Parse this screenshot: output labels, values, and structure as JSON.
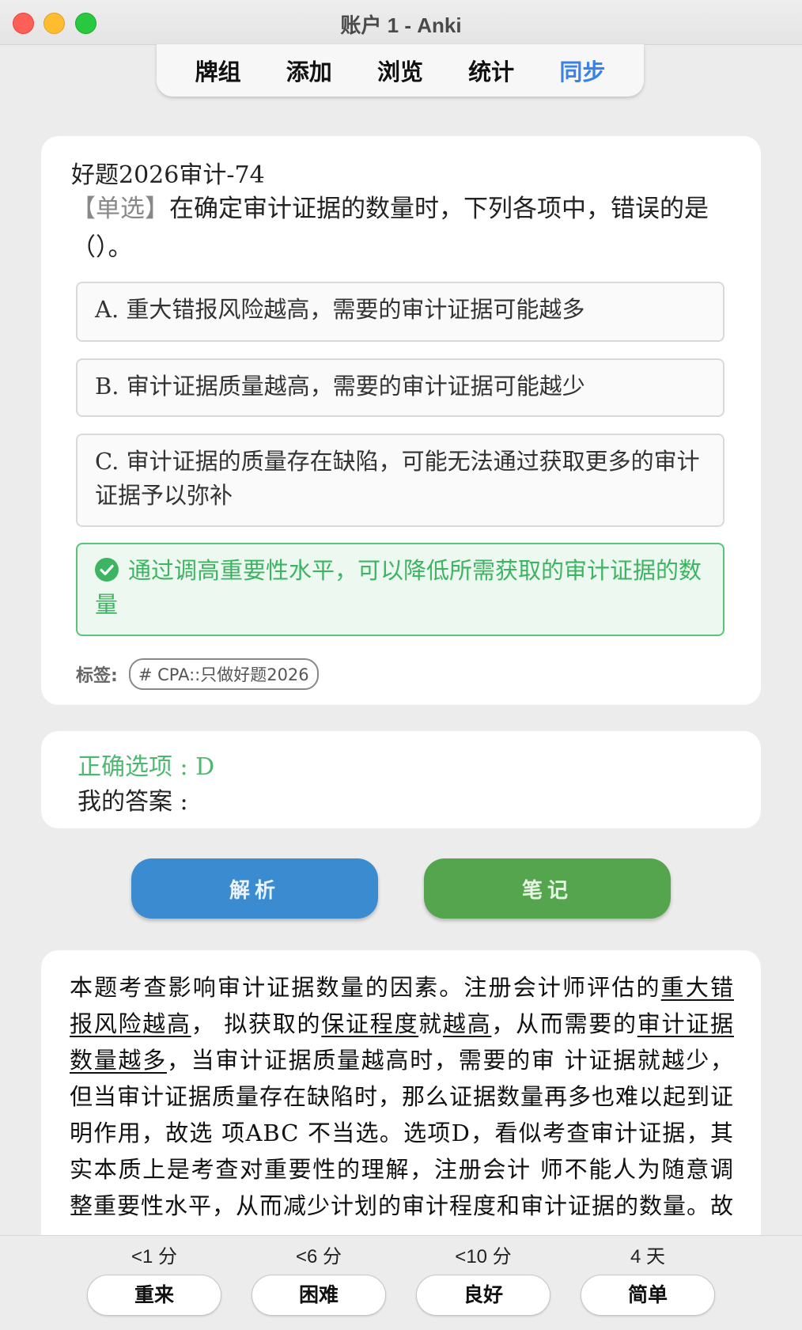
{
  "window": {
    "title": "账户 1 - Anki"
  },
  "nav": {
    "items": [
      "牌组",
      "添加",
      "浏览",
      "统计",
      "同步"
    ],
    "active": "同步"
  },
  "question": {
    "deck_title": "好题2026审计-74",
    "type_label": "【单选】",
    "stem": "在确定审计证据的数量时，下列各项中，错误的是（）。",
    "options": {
      "a": "A. 重大错报风险越高，需要的审计证据可能越多",
      "b": "B. 审计证据质量越高，需要的审计证据可能越少",
      "c": "C. 审计证据的质量存在缺陷，可能无法通过获取更多的审计证据予以弥补",
      "d": "通过调高重要性水平，可以降低所需获取的审计证据的数量"
    },
    "tags_label": "标签:",
    "tag": "# CPA::只做好题2026"
  },
  "answer": {
    "correct": "正确选项 : D",
    "mine": "我的答案 :"
  },
  "buttons": {
    "analysis": "解析",
    "notes": "笔记"
  },
  "explanation": {
    "p1": "本题考查影响审计证据数量的因素。注册会计师评估的",
    "u1": "重大错报风险越高",
    "p2": "， 拟获取的",
    "u2": "保证程度",
    "p3": "就",
    "u3": "越高",
    "p4": "，从而需要的",
    "u4": "审计证据数量越多",
    "p5": "，当审计证据质量越高时，需要的审 计证据就越少，但当审计证据质量存在缺陷时，那么证据数量再多也难以起到证明作用，故选 项ABC 不当选。选项D，看似考查审计证据，其实本质上是考查对重要性的理解，注册会计 师不能人为随意调整重要性水平，从而减少计划的审计程度和审计证据的数量。故"
  },
  "ease": [
    {
      "time": "<1 分",
      "label": "重来"
    },
    {
      "time": "<6 分",
      "label": "困难"
    },
    {
      "time": "<10 分",
      "label": "良好"
    },
    {
      "time": "4 天",
      "label": "简单"
    }
  ],
  "colors": {
    "correct_green": "#3db462",
    "sync_blue": "#3a82e8",
    "analysis_blue": "#3a8bd0",
    "notes_green": "#55a54f"
  }
}
